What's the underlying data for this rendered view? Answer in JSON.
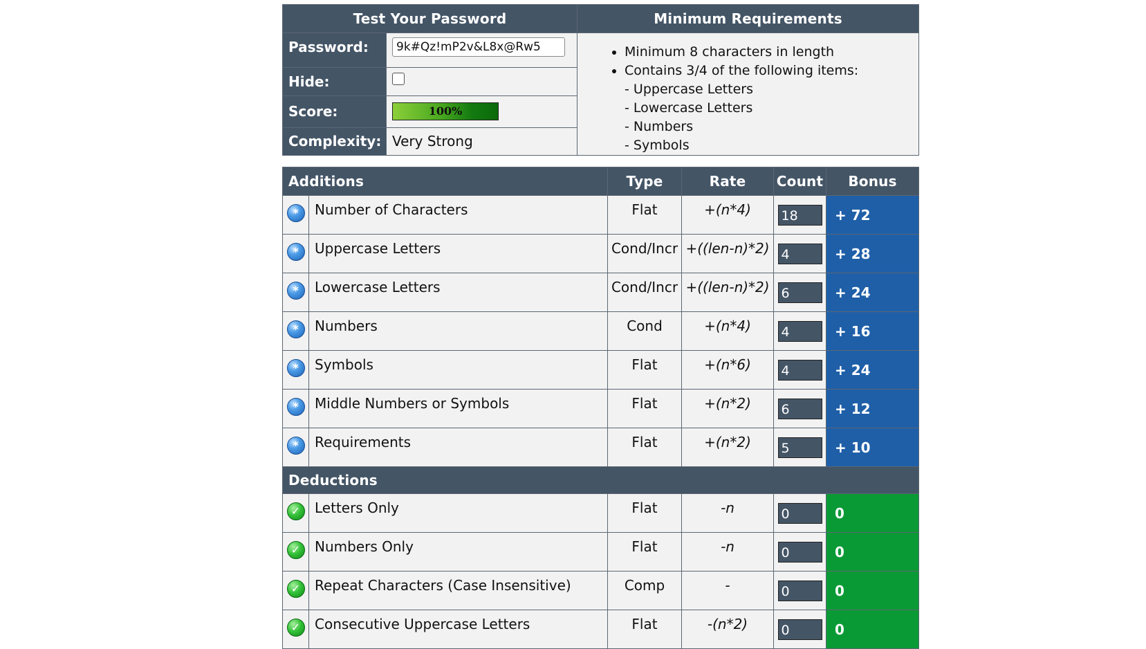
{
  "test": {
    "title": "Test Your Password",
    "password_label": "Password:",
    "password_value": "9k#Qz!mP2v&L8x@Rw5",
    "hide_label": "Hide:",
    "hide_checked": false,
    "score_label": "Score:",
    "score_text": "100%",
    "score_fraction": 1.0,
    "complexity_label": "Complexity:",
    "complexity_value": "Very Strong"
  },
  "requirements": {
    "title": "Minimum Requirements",
    "items": [
      "Minimum 8 characters in length",
      "Contains 3/4 of the following items:"
    ],
    "subitems": [
      "- Uppercase Letters",
      "- Lowercase Letters",
      "- Numbers",
      "- Symbols"
    ]
  },
  "table": {
    "additions_header": "Additions",
    "type_header": "Type",
    "rate_header": "Rate",
    "count_header": "Count",
    "bonus_header": "Bonus",
    "deductions_header": "Deductions",
    "additions": [
      {
        "name": "Number of Characters",
        "type": "Flat",
        "rate": "+(n*4)",
        "count": "18",
        "bonus": "+ 72"
      },
      {
        "name": "Uppercase Letters",
        "type": "Cond/Incr",
        "rate": "+((len-n)*2)",
        "count": "4",
        "bonus": "+ 28"
      },
      {
        "name": "Lowercase Letters",
        "type": "Cond/Incr",
        "rate": "+((len-n)*2)",
        "count": "6",
        "bonus": "+ 24"
      },
      {
        "name": "Numbers",
        "type": "Cond",
        "rate": "+(n*4)",
        "count": "4",
        "bonus": "+ 16"
      },
      {
        "name": "Symbols",
        "type": "Flat",
        "rate": "+(n*6)",
        "count": "4",
        "bonus": "+ 24"
      },
      {
        "name": "Middle Numbers or Symbols",
        "type": "Flat",
        "rate": "+(n*2)",
        "count": "6",
        "bonus": "+ 12"
      },
      {
        "name": "Requirements",
        "type": "Flat",
        "rate": "+(n*2)",
        "count": "5",
        "bonus": "+ 10"
      }
    ],
    "deductions": [
      {
        "name": "Letters Only",
        "type": "Flat",
        "rate": "-n",
        "count": "0",
        "bonus": "0"
      },
      {
        "name": "Numbers Only",
        "type": "Flat",
        "rate": "-n",
        "count": "0",
        "bonus": "0"
      },
      {
        "name": "Repeat Characters (Case Insensitive)",
        "type": "Comp",
        "rate": "-",
        "count": "0",
        "bonus": "0"
      },
      {
        "name": "Consecutive Uppercase Letters",
        "type": "Flat",
        "rate": "-(n*2)",
        "count": "0",
        "bonus": "0"
      }
    ]
  },
  "colors": {
    "header_bg": "#445566",
    "bonus_blue": "#1f5fa8",
    "bonus_green": "#0a9a35"
  },
  "icons": {
    "addition": "plus-bubble-icon",
    "deduction": "check-circle-icon"
  }
}
